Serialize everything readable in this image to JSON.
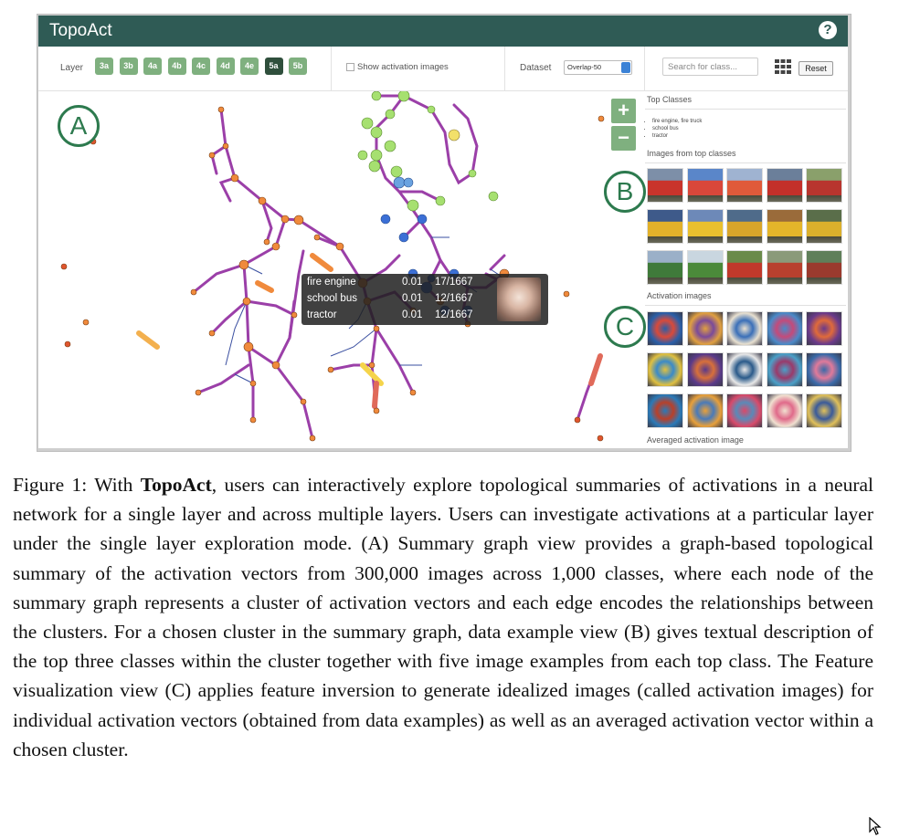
{
  "app": {
    "title": "TopoAct",
    "help_icon": "help-icon"
  },
  "toolbar": {
    "layer_label": "Layer",
    "layers": [
      "3a",
      "3b",
      "4a",
      "4b",
      "4c",
      "4d",
      "4e",
      "5a",
      "5b"
    ],
    "active_layer": "5a",
    "show_activation_label": "Show activation images",
    "dataset_label": "Dataset",
    "dataset_value": "Overlap-50",
    "search_placeholder": "Search for class...",
    "grid_icon": "grid-icon",
    "reset_label": "Reset"
  },
  "graph": {
    "label": "A",
    "zoom_in": "+",
    "zoom_out": "−"
  },
  "tooltip": {
    "rows": [
      {
        "name": "fire engine",
        "value": "0.01",
        "count": "17/1667"
      },
      {
        "name": "school bus",
        "value": "0.01",
        "count": "12/1667"
      },
      {
        "name": "tractor",
        "value": "0.01",
        "count": "12/1667"
      }
    ]
  },
  "sidebar": {
    "top_classes_title": "Top Classes",
    "top_classes": [
      "fire engine, fire truck",
      "school bus",
      "tractor"
    ],
    "images_title": "Images from top classes",
    "images_label": "B",
    "activation_title": "Activation images",
    "activation_label": "C",
    "averaged_title": "Averaged activation image"
  },
  "caption": {
    "prefix": "Figure 1: With ",
    "name": "TopoAct",
    "text": ", users can interactively explore topological summaries of activations in a neural network for a single layer and across multiple layers. Users can investigate activations at a particular layer under the single layer exploration mode. (A) Summary graph view provides a graph-based topological summary of the activation vectors from 300,000 images across 1,000 classes, where each node of the summary graph represents a cluster of activation vectors and each edge encodes the relationships between the clusters. For a chosen cluster in the summary graph, data example view (B) gives textual description of the top three classes within the cluster together with five image examples from each top class. The Feature visualization view (C) applies feature inversion to generate idealized images (called activation images) for individual activation vectors (obtained from data examples) as well as an averaged activation vector within a chosen cluster."
  },
  "colors": {
    "header": "#2f5b55",
    "layer_button": "#7fb07f",
    "layer_button_active": "#2f4f3c",
    "edge": "#9b3fa8",
    "node_orange": "#f08a3c",
    "node_green": "#a6e070",
    "node_blue": "#3b6fd6",
    "label_circle": "#2d7a4e"
  }
}
